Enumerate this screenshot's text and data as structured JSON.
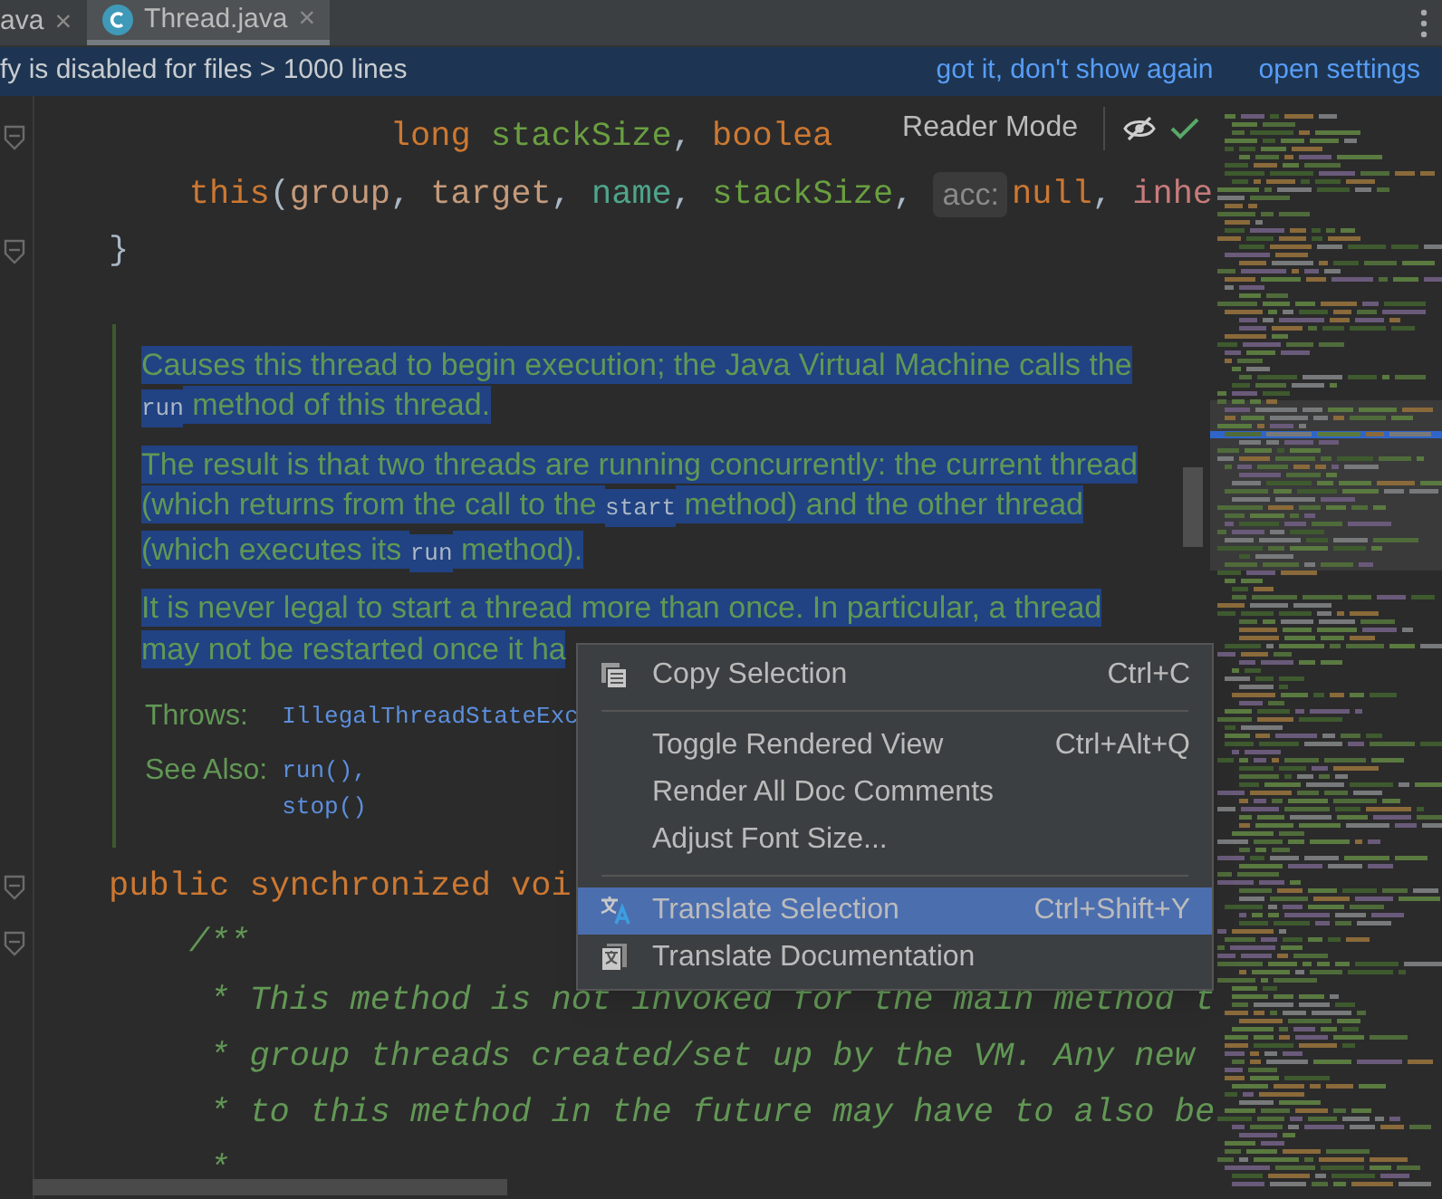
{
  "tabs": [
    {
      "label": "ava",
      "selected": false,
      "has_icon": false,
      "close": "×"
    },
    {
      "label": "Thread.java",
      "selected": true,
      "has_icon": true,
      "close": "×"
    }
  ],
  "banner": {
    "text": "fy is disabled for files > 1000 lines",
    "actions": [
      "got it, don't show again",
      "open settings"
    ]
  },
  "reader_mode": {
    "label": "Reader Mode"
  },
  "code_top": [
    {
      "fold": true,
      "tokens": [
        {
          "kind": "keyword",
          "text": "long "
        },
        {
          "kind": "param",
          "text": "stackSize"
        },
        {
          "kind": "plain",
          "text": ", "
        },
        {
          "kind": "keyword",
          "text": "boolea"
        }
      ]
    },
    {
      "fold": false,
      "tokens": [
        {
          "kind": "keyword",
          "text": "this"
        },
        {
          "kind": "plain",
          "text": "("
        },
        {
          "kind": "arg",
          "text": "group"
        },
        {
          "kind": "plain",
          "text": ", "
        },
        {
          "kind": "arg",
          "text": "target"
        },
        {
          "kind": "plain",
          "text": ", "
        },
        {
          "kind": "field",
          "text": "name"
        },
        {
          "kind": "plain",
          "text": ", "
        },
        {
          "kind": "param",
          "text": "stackSize"
        },
        {
          "kind": "plain",
          "text": ", "
        },
        {
          "kind": "hint",
          "text": "acc:"
        },
        {
          "kind": "keyword",
          "text": "null"
        },
        {
          "kind": "plain",
          "text": ", "
        },
        {
          "kind": "local",
          "text": "inhe"
        }
      ]
    },
    {
      "fold": true,
      "tokens": [
        {
          "kind": "plain",
          "text": "}"
        }
      ]
    }
  ],
  "doc": {
    "paragraphs": [
      [
        {
          "kind": "text",
          "text": "Causes this thread to begin execution; the Java Virtual Machine calls the "
        },
        {
          "kind": "code",
          "text": "run"
        },
        {
          "kind": "text",
          "text": " method of this thread."
        }
      ],
      [
        {
          "kind": "text",
          "text": "The result is that two threads are running concurrently: the current thread (which returns from the call to the "
        },
        {
          "kind": "code",
          "text": "start"
        },
        {
          "kind": "text",
          "text": " method) and the other thread (which executes its "
        },
        {
          "kind": "code",
          "text": "run"
        },
        {
          "kind": "text",
          "text": " method)."
        }
      ],
      [
        {
          "kind": "text",
          "text": "It is never legal to start a thread more than once. In particular, a thread may not be restarted once it ha"
        }
      ]
    ],
    "tags": [
      {
        "label": "Throws:",
        "values": [
          "IllegalThreadStateExc"
        ]
      },
      {
        "label": "See Also:",
        "values": [
          "run(),",
          "stop()"
        ]
      }
    ]
  },
  "code_bottom": [
    {
      "fold": true,
      "tokens": [
        {
          "kind": "keyword",
          "text": "public synchronized voi"
        }
      ]
    },
    {
      "fold": true,
      "tokens": [
        {
          "kind": "comment",
          "text": "/**"
        }
      ]
    },
    {
      "fold": false,
      "tokens": [
        {
          "kind": "comment",
          "text": "* This method is not invoked for the main method t"
        }
      ]
    },
    {
      "fold": false,
      "tokens": [
        {
          "kind": "comment",
          "text": "* group threads created/set up by the VM. Any new"
        }
      ]
    },
    {
      "fold": false,
      "tokens": [
        {
          "kind": "comment",
          "text": "* to this method in the future may have to also be"
        }
      ]
    },
    {
      "fold": false,
      "tokens": [
        {
          "kind": "comment",
          "text": "*"
        }
      ]
    }
  ],
  "context_menu": [
    {
      "kind": "copy",
      "label": "Copy Selection",
      "shortcut": "Ctrl+C",
      "selected": false
    },
    {
      "kind": "separator"
    },
    {
      "kind": "plain",
      "label": "Toggle Rendered View",
      "shortcut": "Ctrl+Alt+Q",
      "selected": false
    },
    {
      "kind": "plain",
      "label": "Render All Doc Comments",
      "selected": false
    },
    {
      "kind": "plain",
      "label": "Adjust Font Size...",
      "selected": false
    },
    {
      "kind": "separator"
    },
    {
      "kind": "translate",
      "label": "Translate Selection",
      "shortcut": "Ctrl+Shift+Y",
      "selected": true
    },
    {
      "kind": "document",
      "label": "Translate Documentation",
      "selected": false
    }
  ]
}
